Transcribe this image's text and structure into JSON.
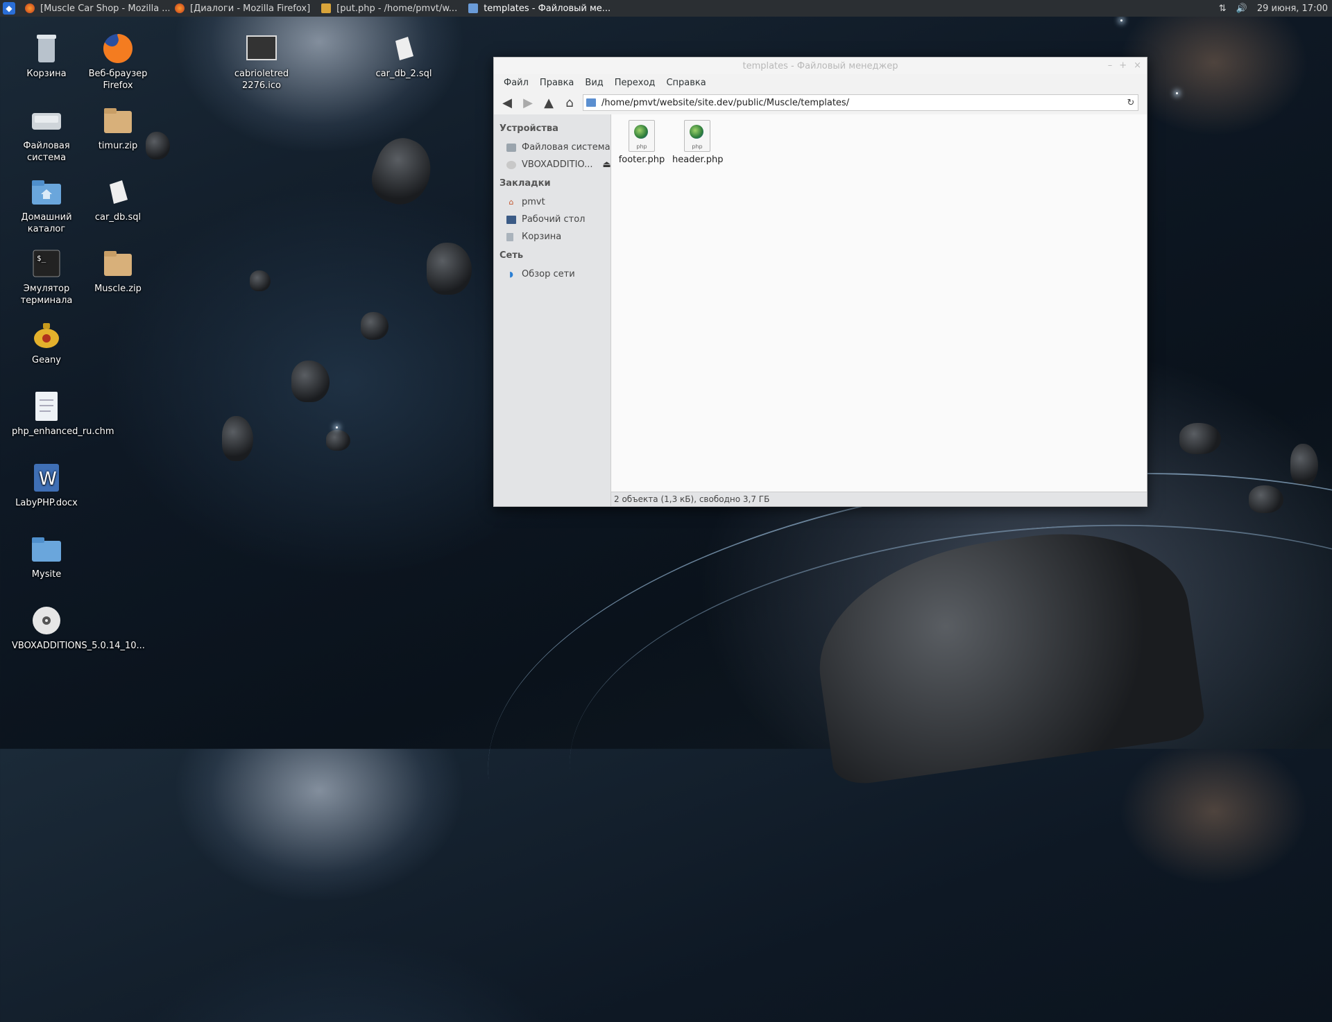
{
  "taskbar": {
    "tasks": [
      {
        "label": "[Muscle Car Shop - Mozilla ..."
      },
      {
        "label": "[Диалоги - Mozilla Firefox]"
      },
      {
        "label": "[put.php - /home/pmvt/w..."
      },
      {
        "label": "templates - Файловый ме..."
      }
    ],
    "clock": "29 июня, 17:00"
  },
  "desktop": {
    "icons": [
      {
        "label": "Корзина"
      },
      {
        "label": "Веб-браузер Firefox"
      },
      {
        "label": "cabrioletred 2276.ico"
      },
      {
        "label": "car_db_2.sql"
      },
      {
        "label": "Файловая система"
      },
      {
        "label": "timur.zip"
      },
      {
        "label": "Домашний каталог"
      },
      {
        "label": "car_db.sql"
      },
      {
        "label": "Эмулятор терминала"
      },
      {
        "label": "Muscle.zip"
      },
      {
        "label": "Geany"
      },
      {
        "label": "php_enhanced_ru.chm"
      },
      {
        "label": "LabyPHP.docx"
      },
      {
        "label": "Mysite"
      },
      {
        "label": "VBOXADDITIONS_5.0.14_10..."
      }
    ]
  },
  "window": {
    "title": "templates - Файловый менеджер",
    "menu": [
      "Файл",
      "Правка",
      "Вид",
      "Переход",
      "Справка"
    ],
    "path": "/home/pmvt/website/site.dev/public/Muscle/templates/",
    "sidebar": {
      "devices_header": "Устройства",
      "devices": [
        "Файловая система",
        "VBOXADDITIO..."
      ],
      "bookmarks_header": "Закладки",
      "bookmarks": [
        "pmvt",
        "Рабочий стол",
        "Корзина"
      ],
      "network_header": "Сеть",
      "network": [
        "Обзор сети"
      ]
    },
    "files": [
      {
        "name": "footer.php",
        "ext": "php"
      },
      {
        "name": "header.php",
        "ext": "php"
      }
    ],
    "status": "2 объекта (1,3 кБ), свободно 3,7 ГБ"
  }
}
